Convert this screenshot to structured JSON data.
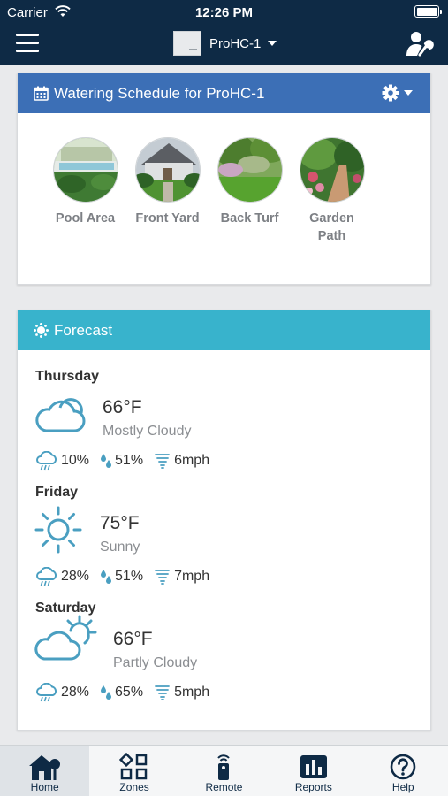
{
  "status_bar": {
    "carrier": "Carrier",
    "time": "12:26 PM"
  },
  "nav": {
    "device_name": "ProHC-1"
  },
  "schedule": {
    "title": "Watering Schedule for ProHC-1",
    "zones": [
      {
        "label": "Pool Area"
      },
      {
        "label": "Front Yard"
      },
      {
        "label": "Back Turf"
      },
      {
        "label": "Garden Path"
      }
    ]
  },
  "forecast": {
    "title": "Forecast",
    "days": [
      {
        "day": "Thursday",
        "temp": "66°F",
        "condition": "Mostly Cloudy",
        "icon": "cloud-icon",
        "precip": "10%",
        "humidity": "51%",
        "wind": "6mph"
      },
      {
        "day": "Friday",
        "temp": "75°F",
        "condition": "Sunny",
        "icon": "sun-icon",
        "precip": "28%",
        "humidity": "51%",
        "wind": "7mph"
      },
      {
        "day": "Saturday",
        "temp": "66°F",
        "condition": "Partly Cloudy",
        "icon": "partly-cloudy-icon",
        "precip": "28%",
        "humidity": "65%",
        "wind": "5mph"
      }
    ]
  },
  "tabs": [
    {
      "label": "Home",
      "icon": "home-icon",
      "active": true
    },
    {
      "label": "Zones",
      "icon": "zones-icon",
      "active": false
    },
    {
      "label": "Remote",
      "icon": "remote-icon",
      "active": false
    },
    {
      "label": "Reports",
      "icon": "reports-icon",
      "active": false
    },
    {
      "label": "Help",
      "icon": "help-icon",
      "active": false
    }
  ],
  "colors": {
    "nav_bg": "#0e2a45",
    "schedule_header": "#3c6fb6",
    "forecast_header": "#38b3cc",
    "weather_icon": "#4a9fc1"
  }
}
